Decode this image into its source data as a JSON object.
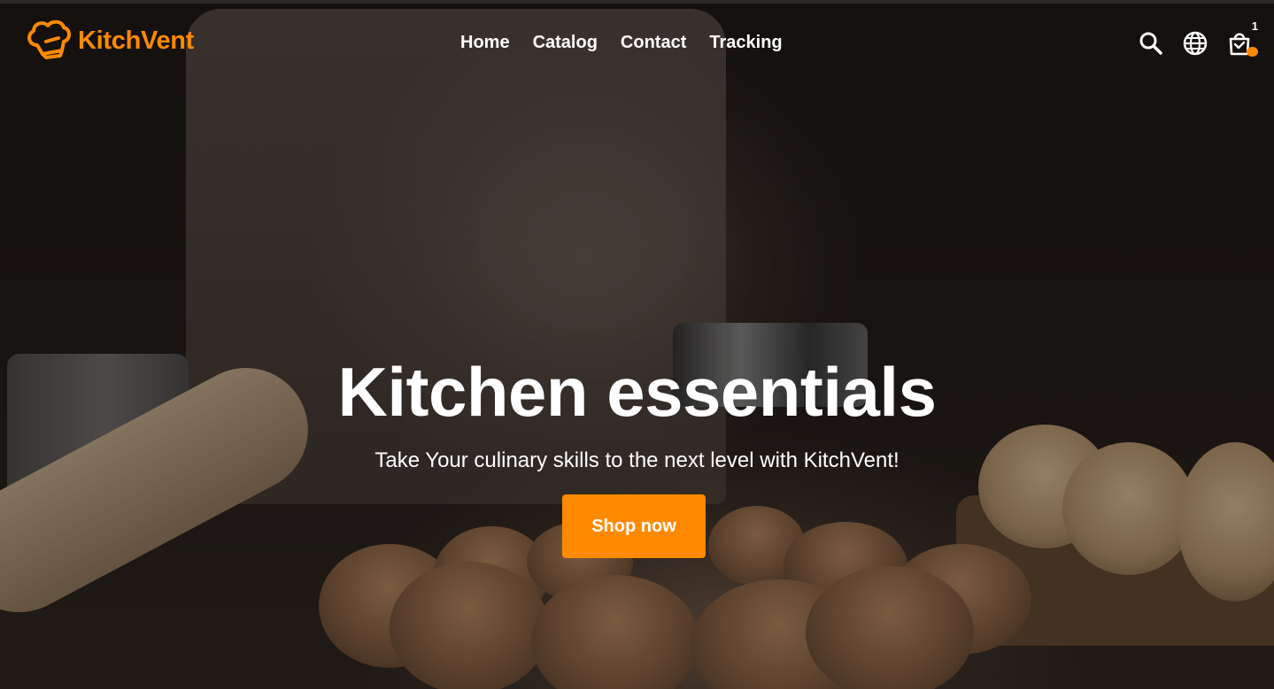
{
  "brand": {
    "name": "KitchVent",
    "accent": "#ff8a00"
  },
  "nav": [
    {
      "label": "Home"
    },
    {
      "label": "Catalog"
    },
    {
      "label": "Contact"
    },
    {
      "label": "Tracking"
    }
  ],
  "header_icons": {
    "search": "search-icon",
    "language": "globe-icon",
    "cart": "shopping-bag-icon"
  },
  "cart": {
    "count": "1"
  },
  "hero": {
    "title": "Kitchen essentials",
    "subtitle": "Take Your culinary skills to the next level with KitchVent!",
    "cta_label": "Shop now"
  }
}
